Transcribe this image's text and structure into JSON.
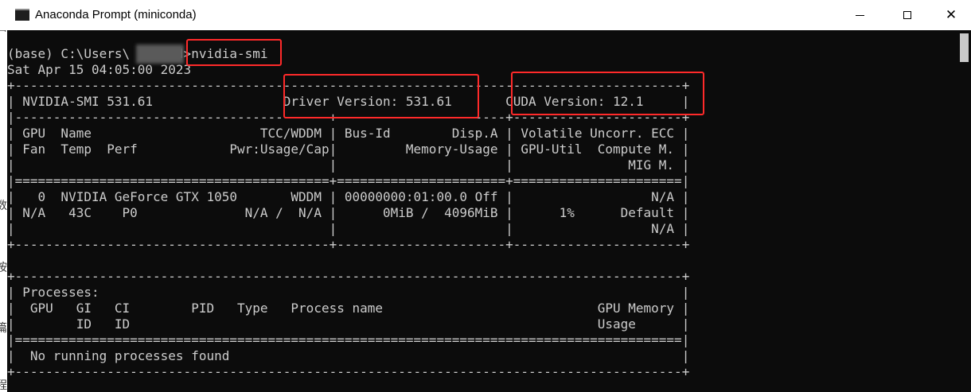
{
  "window": {
    "title": "Anaconda Prompt (miniconda)",
    "buttons": [
      "minimize",
      "maximize",
      "close"
    ]
  },
  "terminal": {
    "lines": [
      "(base) C:\\Users\\      d>nvidia-smi",
      "Sat Apr 15 04:05:00 2023",
      "+---------------------------------------------------------------------------------------+",
      "| NVIDIA-SMI 531.61                 Driver Version: 531.61       CUDA Version: 12.1     |",
      "|-----------------------------------------+----------------------+----------------------+",
      "| GPU  Name                      TCC/WDDM | Bus-Id        Disp.A | Volatile Uncorr. ECC |",
      "| Fan  Temp  Perf            Pwr:Usage/Cap|         Memory-Usage | GPU-Util  Compute M. |",
      "|                                         |                      |               MIG M. |",
      "|=========================================+======================+======================|",
      "|   0  NVIDIA GeForce GTX 1050       WDDM | 00000000:01:00.0 Off |                  N/A |",
      "| N/A   43C    P0              N/A /  N/A |      0MiB /  4096MiB |      1%      Default |",
      "|                                         |                      |                  N/A |",
      "+-----------------------------------------+----------------------+----------------------+",
      "",
      "+---------------------------------------------------------------------------------------+",
      "| Processes:                                                                            |",
      "|  GPU   GI   CI        PID   Type   Process name                            GPU Memory |",
      "|        ID   ID                                                             Usage      |",
      "|=======================================================================================|",
      "|  No running processes found                                                           |",
      "+---------------------------------------------------------------------------------------+"
    ]
  },
  "annotation_color": "#ff2a2a",
  "text_color": "#cccccc",
  "background_color": "#0c0c0c"
}
